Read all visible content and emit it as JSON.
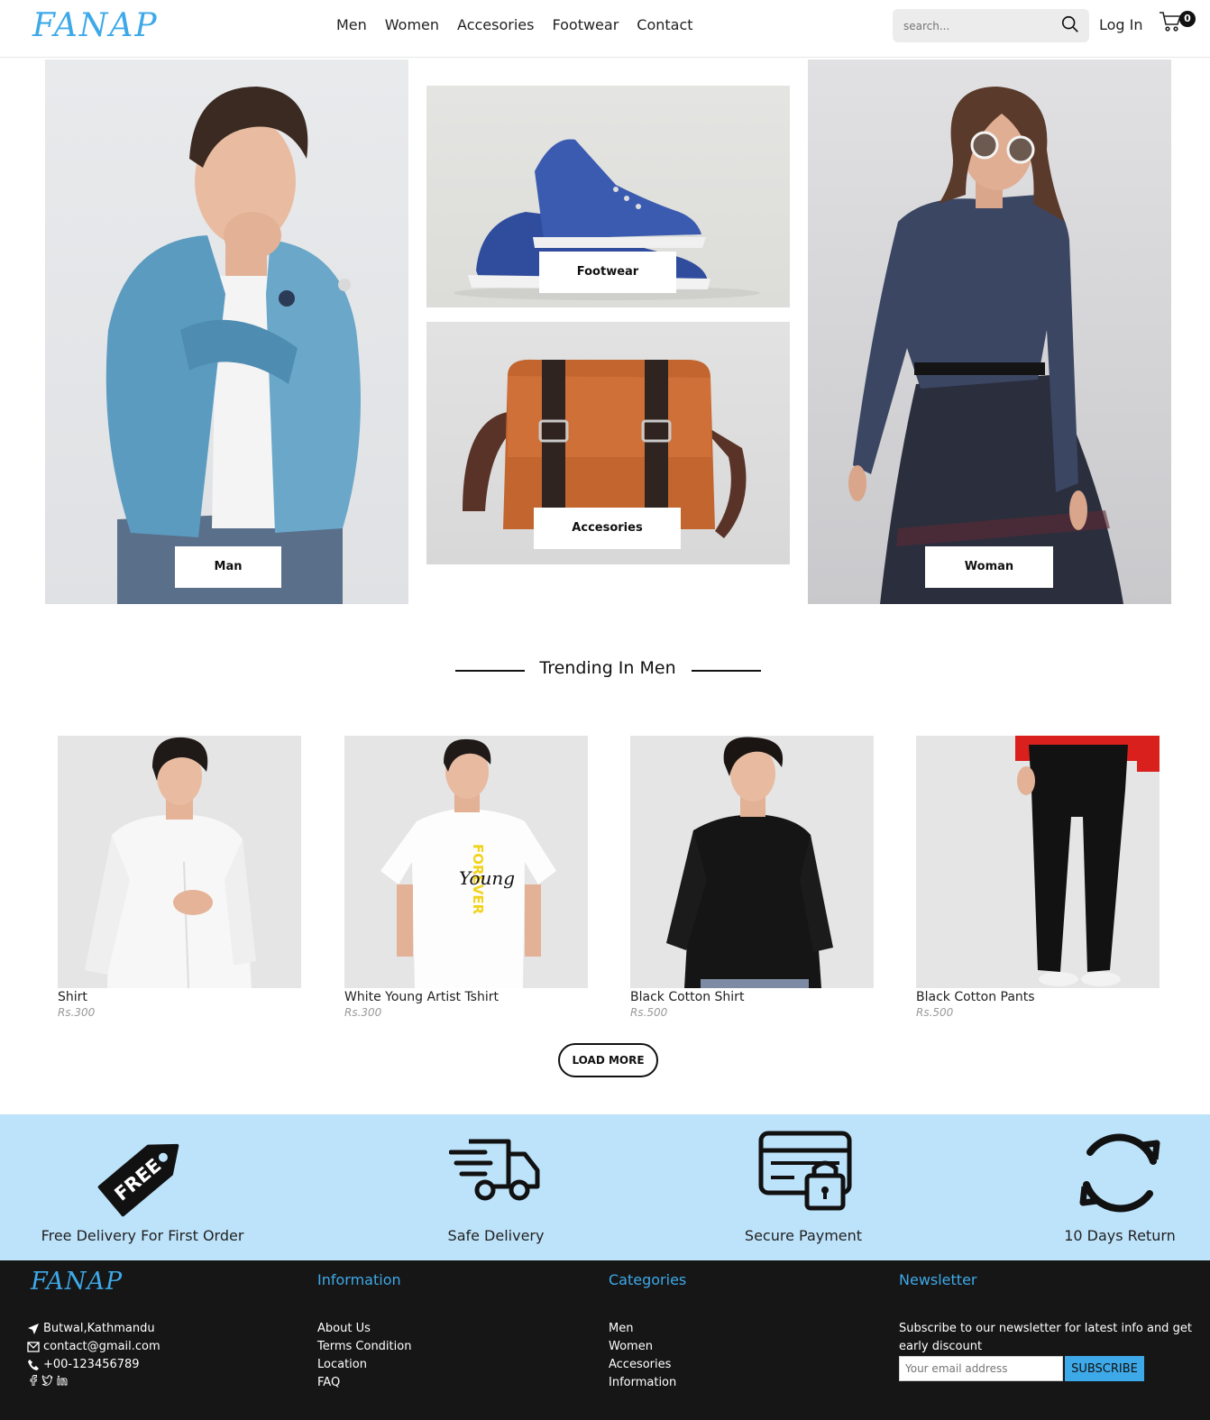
{
  "header": {
    "logo": "FANAP",
    "nav": [
      "Men",
      "Women",
      "Accesories",
      "Footwear",
      "Contact"
    ],
    "search_placeholder": "search...",
    "login": "Log In",
    "cart_count": "0"
  },
  "hero": {
    "man_label": "Man",
    "footwear_label": "Footwear",
    "accesories_label": "Accesories",
    "woman_label": "Woman"
  },
  "trending": {
    "title": "Trending In Men",
    "products": [
      {
        "name": "Shirt",
        "price": "Rs.300"
      },
      {
        "name": "White Young Artist Tshirt",
        "price": "Rs.300"
      },
      {
        "name": "Black Cotton Shirt",
        "price": "Rs.500"
      },
      {
        "name": "Black Cotton Pants",
        "price": "Rs.500"
      }
    ],
    "tshirt_print_vertical": "FOREVER",
    "tshirt_print_script": "Young",
    "load_more": "LOAD MORE"
  },
  "features": [
    {
      "label": "Free Delivery For First Order",
      "icon": "free-tag-icon",
      "tag_text": "FREE"
    },
    {
      "label": "Safe Delivery",
      "icon": "delivery-truck-icon"
    },
    {
      "label": "Secure Payment",
      "icon": "secure-card-icon"
    },
    {
      "label": "10 Days Return",
      "icon": "return-cycle-icon"
    }
  ],
  "footer": {
    "logo": "FANAP",
    "address": "Butwal,Kathmandu",
    "email": "contact@gmail.com",
    "phone": "+00-123456789",
    "information_title": "Information",
    "information_links": [
      "About Us",
      "Terms Condition",
      "Location",
      "FAQ"
    ],
    "categories_title": "Categories",
    "categories_links": [
      "Men",
      "Women",
      "Accesories",
      "Information"
    ],
    "newsletter_title": "Newsletter",
    "newsletter_text": "Subscribe to our newsletter for latest info and get early discount",
    "email_placeholder": "Your email address",
    "subscribe": "SUBSCRIBE"
  },
  "colors": {
    "accent": "#3ea9e8",
    "feature_band": "#bde3fb",
    "footer_bg": "#161616"
  }
}
